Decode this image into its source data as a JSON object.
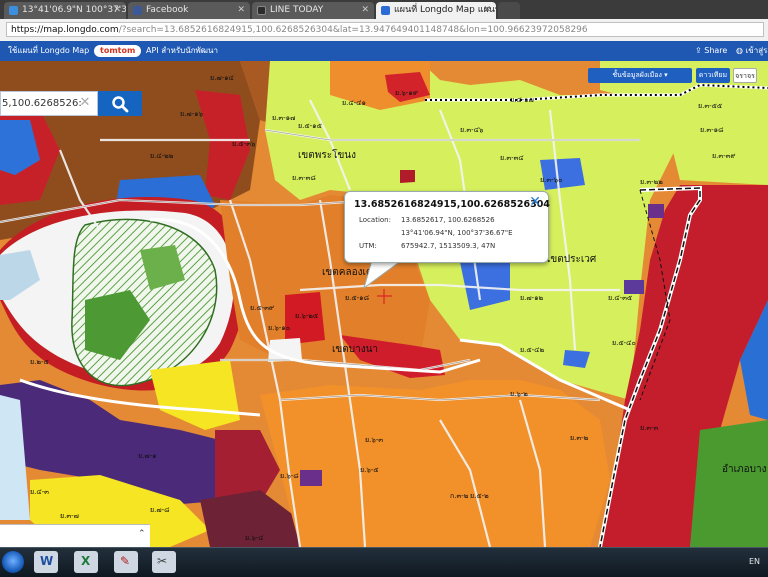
{
  "browser": {
    "tabs": [
      {
        "label": "13°41'06.9\"N 100°37'36...",
        "active": false,
        "favicon_color": "#3c8fde"
      },
      {
        "label": "Facebook",
        "active": false,
        "favicon_color": "#3b5998"
      },
      {
        "label": "LINE TODAY",
        "active": false,
        "favicon_color": "#2c2c2c"
      },
      {
        "label": "แผนที่ Longdo Map แผนที่...",
        "active": true,
        "favicon_color": "#2b6bd6"
      }
    ],
    "url_host": "https://map.longdo.com",
    "url_rest": "/?search=13.6852616824915,100.6268526304&lat=13.947649401148748&lon=100.96623972058296"
  },
  "site_header": {
    "link1": "ใช้แผนที่ Longdo Map",
    "partner": "tomtom",
    "api_link": "API สำหรับนักพัฒนา",
    "share": "Share",
    "signin": "เข้าสู่ระบบ"
  },
  "map": {
    "search_value": "5,100.6268526:",
    "clear_icon": "x-icon",
    "search_icon": "magnifier-icon",
    "layer_button": "ชั้นข้อมูลผังเมือง",
    "mode_button_1": "ดาวเทียม",
    "mode_button_2": "จราจร",
    "place_labels": [
      "เขตพระโขนง",
      "เขตประเวศ",
      "เขตคลองเตย",
      "เขตบางนา",
      "อำเภอบาง"
    ],
    "zone_labels": [
      "ย.๗-๑๔",
      "ย.๗-๑๖",
      "ย.๕-๓๖",
      "ย.๔-๒๒",
      "ย.๓-๑๗",
      "ย.๕-๑๕",
      "ย.๓-๓๘",
      "ย.๔-๔๑",
      "ย.๖-๑๙",
      "ย.๓-๖๐",
      "ย.๔-๑๗",
      "ย.๓-๔๖",
      "ย.๓-๓๔",
      "ย.๓-๕๕",
      "ย.๓-๓๙",
      "ย.๓-๑๘",
      "ย.๓-๒๒",
      "ย.๕-๑๘",
      "ย.๖-๒๕",
      "ย.๕-๓๙",
      "ย.๕-๔๒",
      "ย.๕-๔๐",
      "ย.๔-๓๕",
      "ย.๗-๑๒",
      "ย.๖-๑๐",
      "ย.๖-๒",
      "ย.๖-๓",
      "ย.๖-๕",
      "ย.๔-๓",
      "ย.๓-๗",
      "ย.๖-๘",
      "ย.๗-๑",
      "ย.๕-๒",
      "ย.๗-๘",
      "ก.๓-๒",
      "ย.๓-๒",
      "ย.๓-๓",
      "ย.๒-๕",
      "ย.๖-๔"
    ],
    "colors": {
      "orange": "#f08c2a",
      "dark_orange": "#c8601e",
      "brown": "#8b4a1c",
      "yellow_green": "#d9f25a",
      "red": "#d21a24",
      "dark_red": "#b01c2a",
      "purple": "#4a2a78",
      "yellow": "#f5e61e",
      "blue": "#2a6fd4",
      "green": "#4a9a30",
      "light_green": "#a8d890"
    }
  },
  "popup": {
    "title": "13.6852616824915,100.6268526304",
    "close_icon": "close-x-icon",
    "location_label": "Location:",
    "location_value": "13.6852617, 100.6268526",
    "dms_value": "13°41'06.94\"N, 100°37'36.67\"E",
    "utm_label": "UTM:",
    "utm_value": "675942.7, 1513509.3, 47N"
  },
  "taskbar": {
    "tray_text": "EN",
    "icons": [
      "start-orb-icon",
      "chrome-icon",
      "word-icon",
      "excel-icon",
      "paint-icon",
      "tool-icon"
    ]
  }
}
